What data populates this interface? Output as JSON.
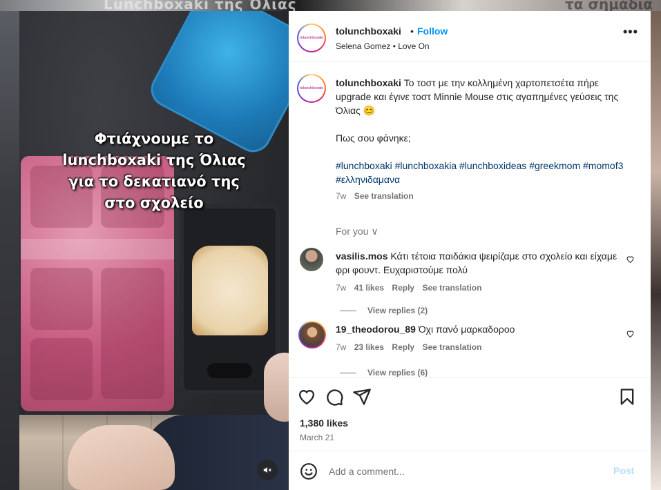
{
  "background": {
    "top_text_left": "Lunchboxaki της Όλιας",
    "top_text_right": "τα σημάδια"
  },
  "post": {
    "username": "tolunchboxaki",
    "separator": "•",
    "follow_label": "Follow",
    "audio": "Selena Gomez • Love On",
    "more_label": "•••",
    "avatar_text": "tolunchboxaki",
    "overlay_text": "Φτιάχνουμε το\nlunchboxaki της Όλιας\nγια το δεκατιανό της\nστο σχολείο"
  },
  "caption": {
    "username": "tolunchboxaki",
    "text": "Το τοστ με την κολλημένη χαρτοπετσέτα πήρε upgrade και έγινε τοστ Minnie Mouse στις αγαπημένες γεύσεις της Όλιας 😊",
    "question": "Πως σου φάνηκε;",
    "hashtags": "#lunchboxaki #lunchboxakia #lunchboxideas #greekmom #momof3 #ελληνιδαμανα",
    "time": "7w",
    "see_translation": "See translation"
  },
  "for_you": "For you ∨",
  "comments": [
    {
      "username": "vasilis.mos",
      "text": "Κάτι τέτοια παιδάκια ψειρίζαμε στο σχολείο και είχαμε φρι φουντ. Ευχαριστούμε πολύ",
      "time": "7w",
      "likes": "41 likes",
      "reply": "Reply",
      "see_translation": "See translation",
      "view_replies": "View replies (2)"
    },
    {
      "username": "19_theodorou_89",
      "text": "Όχι πανό μαρκαδοροο",
      "time": "7w",
      "likes": "23 likes",
      "reply": "Reply",
      "see_translation": "See translation",
      "view_replies": "View replies (6)"
    }
  ],
  "footer": {
    "likes": "1,380 likes",
    "date": "March 21",
    "comment_placeholder": "Add a comment...",
    "post_label": "Post"
  },
  "colors": {
    "link_blue": "#0095f6",
    "hashtag_blue": "#00376b",
    "muted": "#737373",
    "post_disabled": "#b2dffc"
  }
}
